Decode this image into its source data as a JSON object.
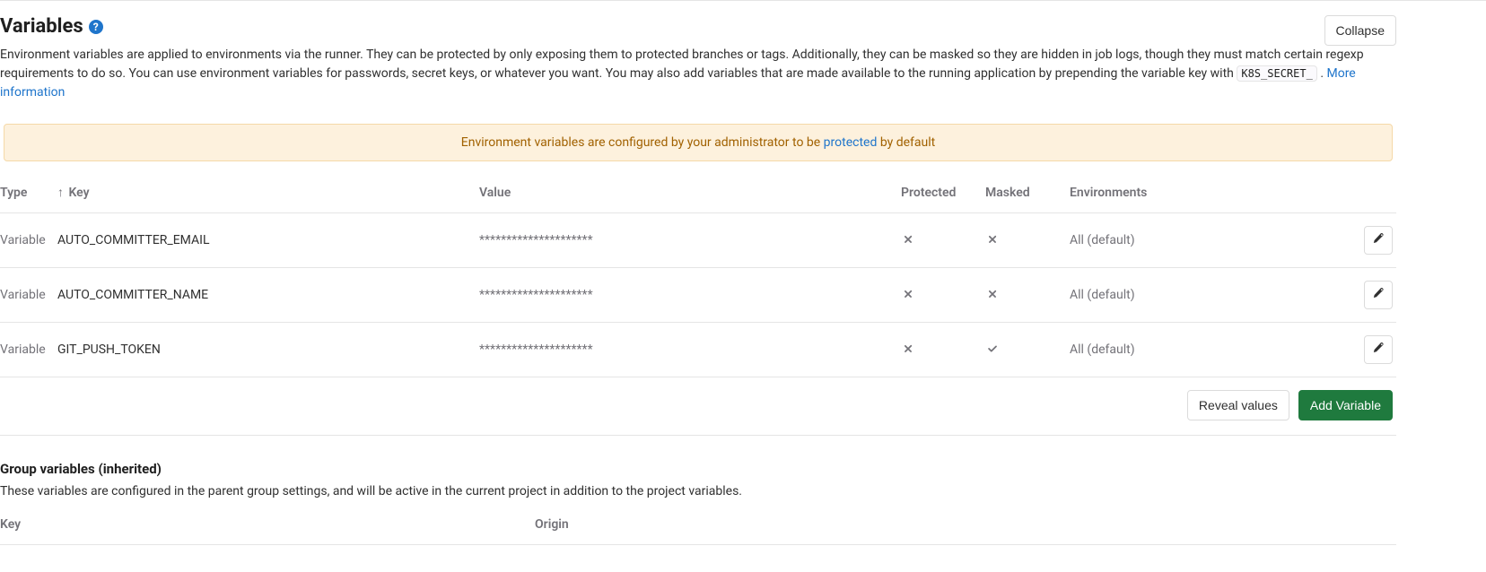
{
  "header": {
    "title": "Variables",
    "collapse_label": "Collapse"
  },
  "description": {
    "text_before_code": "Environment variables are applied to environments via the runner. They can be protected by only exposing them to protected branches or tags. Additionally, they can be masked so they are hidden in job logs, though they must match certain regexp requirements to do so. You can use environment variables for passwords, secret keys, or whatever you want. You may also add variables that are made available to the running application by prepending the variable key with ",
    "code": "K8S_SECRET_",
    "text_after_code": ". ",
    "more_info": "More information"
  },
  "alert": {
    "text_before": "Environment variables are configured by your administrator to be ",
    "link": "protected",
    "text_after": " by default"
  },
  "table": {
    "headers": {
      "type": "Type",
      "key": "Key",
      "value": "Value",
      "protected": "Protected",
      "masked": "Masked",
      "environments": "Environments"
    },
    "rows": [
      {
        "type": "Variable",
        "key": "AUTO_COMMITTER_EMAIL",
        "value": "*********************",
        "protected": false,
        "masked": false,
        "env": "All (default)"
      },
      {
        "type": "Variable",
        "key": "AUTO_COMMITTER_NAME",
        "value": "*********************",
        "protected": false,
        "masked": false,
        "env": "All (default)"
      },
      {
        "type": "Variable",
        "key": "GIT_PUSH_TOKEN",
        "value": "*********************",
        "protected": false,
        "masked": true,
        "env": "All (default)"
      }
    ]
  },
  "actions": {
    "reveal": "Reveal values",
    "add": "Add Variable"
  },
  "group": {
    "title": "Group variables (inherited)",
    "description": "These variables are configured in the parent group settings, and will be active in the current project in addition to the project variables.",
    "headers": {
      "key": "Key",
      "origin": "Origin"
    }
  }
}
